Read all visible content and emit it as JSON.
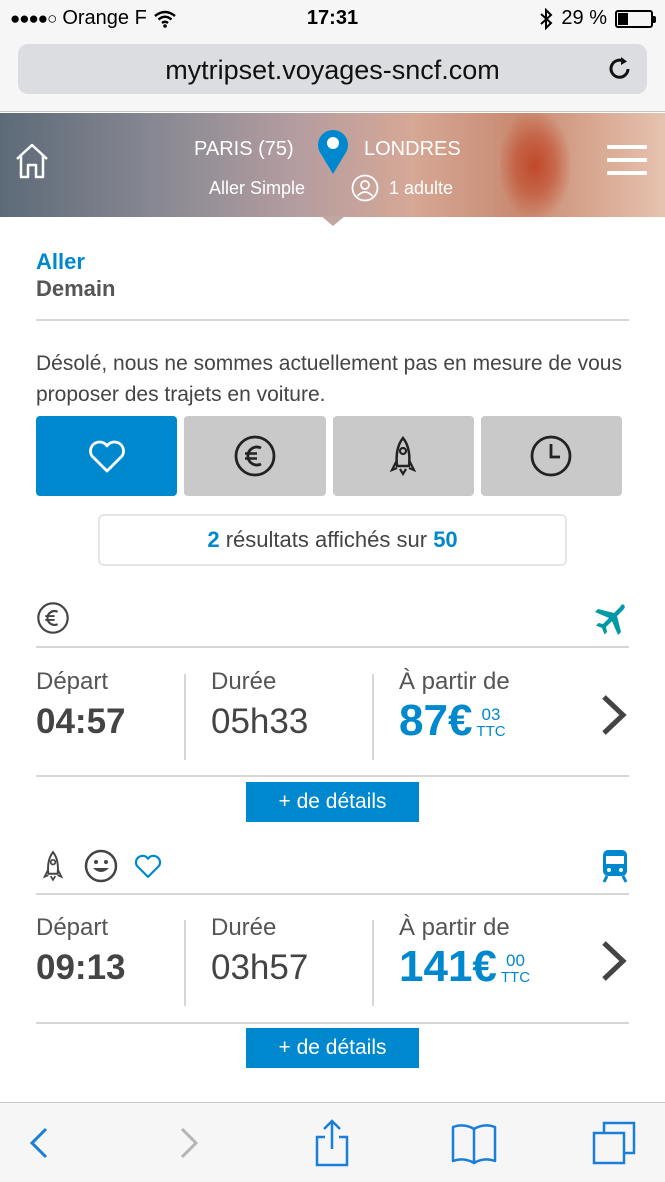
{
  "status_bar": {
    "carrier": "Orange F",
    "time": "17:31",
    "battery": "29 %",
    "battery_level": 0.29
  },
  "browser": {
    "url": "mytripset.voyages-sncf.com"
  },
  "header": {
    "from": "PARIS (75)",
    "to": "LONDRES",
    "trip_type": "Aller Simple",
    "passengers": "1 adulte"
  },
  "journey": {
    "direction": "Aller",
    "date": "Demain"
  },
  "notice": "Désolé, nous ne sommes actuellement pas en mesure de vous proposer des trajets en voiture.",
  "sort_tabs": [
    {
      "icon": "heart-icon",
      "active": true
    },
    {
      "icon": "euro-icon",
      "active": false
    },
    {
      "icon": "rocket-icon",
      "active": false
    },
    {
      "icon": "clock-icon",
      "active": false
    }
  ],
  "results": {
    "shown": "2",
    "middle": "résultats affichés sur",
    "total": "50"
  },
  "offers": [
    {
      "tags": [
        "euro-icon"
      ],
      "mode": "plane-icon",
      "depart_label": "Départ",
      "depart": "04:57",
      "duration_label": "Durée",
      "duration": "05h33",
      "price_label": "À partir de",
      "price": "87€",
      "cents": "03",
      "ttc": "TTC",
      "details": "+ de détails"
    },
    {
      "tags": [
        "rocket-icon",
        "smiley-icon",
        "heart-icon"
      ],
      "mode": "train-icon",
      "depart_label": "Départ",
      "depart": "09:13",
      "duration_label": "Durée",
      "duration": "03h57",
      "price_label": "À partir de",
      "price": "141€",
      "cents": "00",
      "ttc": "TTC",
      "details": "+ de détails"
    }
  ],
  "colors": {
    "accent": "#0088ce",
    "tab_inactive": "#c9c9c9",
    "mode_icon": "#009aa6"
  }
}
